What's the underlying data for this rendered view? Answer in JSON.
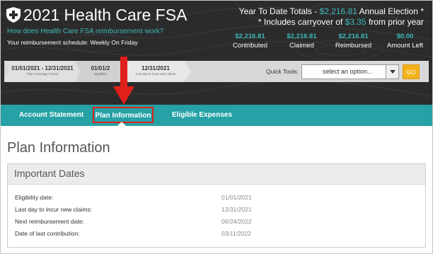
{
  "header": {
    "app_title": "2021 Health Care FSA",
    "help_link": "How does Health Care FSA reimbursement work?",
    "schedule": "Your reimbursement schedule: Weekly On Friday",
    "ytd_prefix": "Year To Date Totals - ",
    "ytd_amount": "$2,216.81",
    "ytd_suffix": " Annual Election *",
    "carryover_prefix": "* Includes carryover of ",
    "carryover_amount": "$3.35",
    "carryover_suffix": " from prior year",
    "stats": [
      {
        "value": "$2,216.81",
        "label": "Contributed"
      },
      {
        "value": "$2,216.81",
        "label": "Claimed"
      },
      {
        "value": "$2,216.81",
        "label": "Reimbursed"
      },
      {
        "value": "$0.00",
        "label": "Amount Left"
      }
    ]
  },
  "timeline": [
    {
      "date": "01/01/2021 - 12/31/2021",
      "sub": "Plan Coverage Period"
    },
    {
      "date": "01/01/2",
      "sub": "Eligibility"
    },
    {
      "date": "12/31/2021",
      "sub": "Last day to incur new claims"
    }
  ],
  "quick_tools": {
    "label": "Quick Tools:",
    "selected": "select an option...",
    "go_label": "GO"
  },
  "nav": {
    "items": [
      {
        "label": "Account Statement"
      },
      {
        "label": "Plan Information"
      },
      {
        "label": "Eligible Expenses"
      }
    ]
  },
  "main": {
    "page_title": "Plan Information",
    "panel_title": "Important Dates",
    "rows": [
      {
        "label": "Eligibility date:",
        "value": "01/01/2021"
      },
      {
        "label": "Last day to incur new claims:",
        "value": "12/31/2021"
      },
      {
        "label": "Next reimbursement date:",
        "value": "06/24/2022"
      },
      {
        "label": "Date of last contribution:",
        "value": "03/11/2022"
      }
    ]
  },
  "colors": {
    "accent": "#26a1a5",
    "highlight": "#3fb6ba",
    "header_bg": "#2b2b2b",
    "go_button": "#f3b21b",
    "annotation": "#e0201a"
  },
  "icons": {
    "logo": "shield-cross-icon",
    "dropdown": "chevron-down-icon",
    "annotation": "arrow-down-icon"
  }
}
